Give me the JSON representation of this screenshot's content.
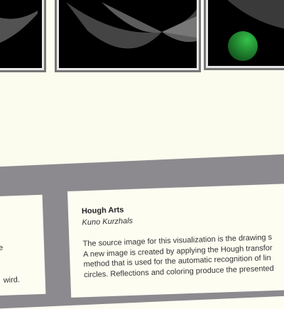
{
  "artwork": {
    "title": "Hough Arts",
    "author": "Kuno Kurzhals",
    "description_lines": [
      "The source image for this visualization is the drawing s",
      "A new image is created by applying the Hough transfor",
      "method that is used for the automatic recognition of lin",
      "circles. Reflections and coloring produce the presented"
    ]
  },
  "left_panel": {
    "fragment_1": "e",
    "fragment_2": "wird."
  },
  "colors": {
    "sphere": "#1f8a2e",
    "wall": "#fbfbee",
    "band": "#8c8a8e"
  }
}
